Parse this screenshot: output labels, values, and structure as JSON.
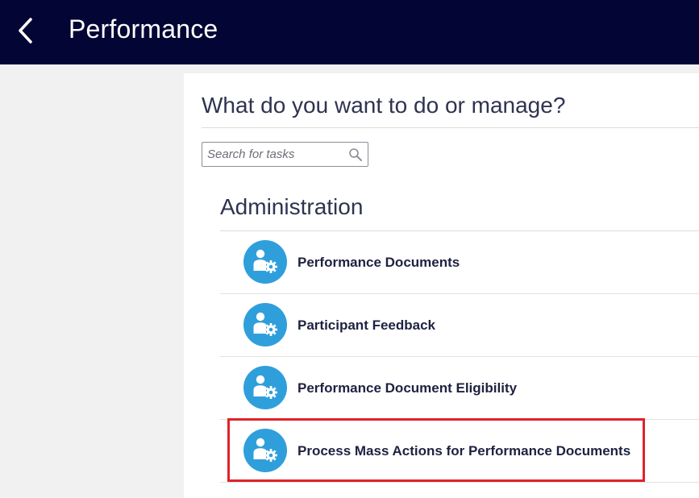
{
  "header": {
    "title": "Performance",
    "back_icon": "chevron-left-icon",
    "background_color": "#030535"
  },
  "main": {
    "question": "What do you want to do or manage?",
    "search": {
      "placeholder": "Search for tasks",
      "value": "",
      "icon": "search-icon"
    },
    "section": {
      "title": "Administration",
      "items": [
        {
          "label": "Performance Documents",
          "icon": "person-gear-icon"
        },
        {
          "label": "Participant Feedback",
          "icon": "person-gear-icon"
        },
        {
          "label": "Performance Document Eligibility",
          "icon": "person-gear-icon"
        },
        {
          "label": "Process Mass Actions for Performance Documents",
          "icon": "person-gear-icon",
          "highlighted": true
        }
      ]
    }
  },
  "colors": {
    "accent": "#2f9fdc",
    "highlight": "#e0222a"
  }
}
